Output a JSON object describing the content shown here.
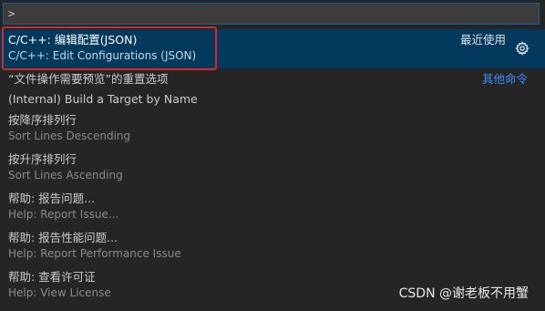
{
  "input": {
    "value": ">"
  },
  "items": [
    {
      "label": "C/C++: 编辑配置(JSON)",
      "detail": "C/C++: Edit Configurations (JSON)",
      "badge": "最近使用",
      "icon": "gear-icon",
      "selected": true
    },
    {
      "label": "“文件操作需要预览”的重置选项",
      "link": "其他命令"
    },
    {
      "label": "(Internal) Build a Target by Name"
    },
    {
      "label": "按降序排列行",
      "detail": "Sort Lines Descending"
    },
    {
      "label": "按升序排列行",
      "detail": "Sort Lines Ascending"
    },
    {
      "label": "帮助: 报告问题...",
      "detail": "Help: Report Issue..."
    },
    {
      "label": "帮助: 报告性能问题...",
      "detail": "Help: Report Performance Issue"
    },
    {
      "label": "帮助: 查看许可证",
      "detail": "Help: View License"
    }
  ],
  "watermark": "CSDN @谢老板不用蟹",
  "colors": {
    "background": "#252526",
    "selected_row": "#04395e",
    "input_border": "#0e639c",
    "link": "#3794ff",
    "annotation_box": "#e0251f"
  }
}
